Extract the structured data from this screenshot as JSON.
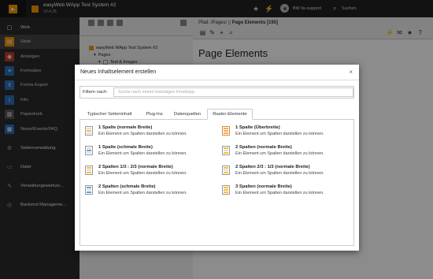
{
  "topbar": {
    "site_title": "easyWeb WApp Test System #2",
    "site_version": "10.4.28",
    "user_name": "BW its-support",
    "search_label": "Suchen"
  },
  "sidebar": {
    "items": [
      {
        "label": "Web",
        "icon": "chevron-icon",
        "group": true
      },
      {
        "label": "Seite",
        "icon": "page-icon",
        "color": "#f49700",
        "active": true
      },
      {
        "label": "Anzeigen",
        "icon": "eye-icon",
        "color": "#c0392b"
      },
      {
        "label": "Formulare",
        "icon": "form-icon",
        "color": "#2a6fb8"
      },
      {
        "label": "Forms Export",
        "icon": "export-icon",
        "color": "#2a6fb8"
      },
      {
        "label": "Info",
        "icon": "info-icon",
        "color": "#2a6fb8"
      },
      {
        "label": "Papierkorb",
        "icon": "trash-icon",
        "color": "#555"
      },
      {
        "label": "News/Events/FAQ",
        "icon": "news-icon",
        "color": "#2a6fb8"
      },
      {
        "label": "Seitenverwaltung",
        "icon": "chevron-icon",
        "group": true
      },
      {
        "label": "Datei",
        "icon": "chevron-icon",
        "group": true
      },
      {
        "label": "Verwaltungswerkze...",
        "icon": "chevron-icon",
        "group": true
      },
      {
        "label": "Backend Manageme...",
        "icon": "chevron-icon",
        "group": true
      }
    ]
  },
  "tree": {
    "root": "easyWeb WApp Test System #2",
    "node1": "Pages",
    "node2": "Text & Images"
  },
  "content": {
    "path_prefix": "Pfad: /Pages/",
    "path_page": "Page Elements [195]",
    "page_title": "Page Elements"
  },
  "modal": {
    "title": "Neues Inhaltselement erstellen",
    "close": "×",
    "filter_label": "Filtern nach:",
    "filter_placeholder": "Suche nach einem beliebigen Inhaltstyp",
    "tabs": [
      "Typischer Seiteninhalt",
      "Plug-Ins",
      "Datenquellen",
      "Raster-Elemente"
    ],
    "active_tab": "Raster-Elemente",
    "elements": [
      {
        "title": "1 Spalte (normale Breite)",
        "desc": "Ein Element um Spalten darstellen zu können.",
        "icon": "grid-icon"
      },
      {
        "title": "1 Spalte (Überbreite)",
        "desc": "Ein Element um Spalten darstellen zu können.",
        "icon": "grid-icon"
      },
      {
        "title": "1 Spalte (schmale Breite)",
        "desc": "Ein Element um Spalten darstellen zu können.",
        "icon": "grid-icon"
      },
      {
        "title": "2 Spalten (normale Breite)",
        "desc": "Ein Element um Spalten darstellen zu können.",
        "icon": "grid-icon"
      },
      {
        "title": "2 Spalten 1/3 : 2/3 (normale Breite)",
        "desc": "Ein Element um Spalten darstellen zu können.",
        "icon": "grid-icon"
      },
      {
        "title": "2 Spalten 2/3 : 1/3 (normale Breite)",
        "desc": "Ein Element um Spalten darstellen zu können.",
        "icon": "grid-icon"
      },
      {
        "title": "2 Spalten (schmale Breite)",
        "desc": "Ein Element um Spalten darstellen zu können.",
        "icon": "grid-icon"
      },
      {
        "title": "3 Spalten (normale Breite)",
        "desc": "Ein Element um Spalten darstellen zu können.",
        "icon": "grid-icon"
      }
    ]
  }
}
